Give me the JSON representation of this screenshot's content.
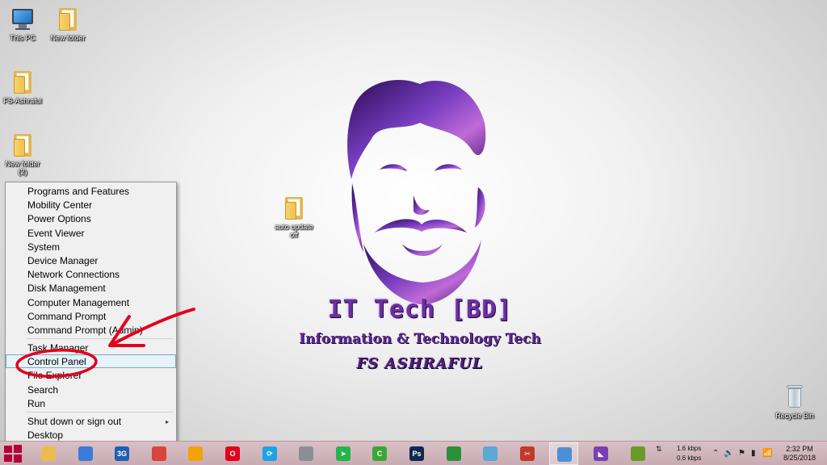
{
  "desktop": {
    "icons": [
      {
        "label": "This PC",
        "icon": "this-pc-icon"
      },
      {
        "label": "New folder",
        "icon": "folder-icon"
      },
      {
        "label": "FS-Ashraful",
        "icon": "folder-icon"
      },
      {
        "label": "New folder\n(2)",
        "icon": "folder-icon"
      },
      {
        "label": "auto update\noff",
        "icon": "folder-icon"
      },
      {
        "label": "Recycle Bin",
        "icon": "recycle-bin-icon"
      }
    ]
  },
  "wallpaper": {
    "title": "IT Tech [BD]",
    "subtitle": "Information & Technology Tech",
    "author": "FS ASHRAFUL"
  },
  "winx_menu": {
    "items": [
      "Programs and Features",
      "Mobility Center",
      "Power Options",
      "Event Viewer",
      "System",
      "Device Manager",
      "Network Connections",
      "Disk Management",
      "Computer Management",
      "Command Prompt",
      "Command Prompt (Admin)",
      "Task Manager",
      "Control Panel",
      "File Explorer",
      "Search",
      "Run",
      "Shut down or sign out",
      "Desktop"
    ],
    "selected": "Control Panel",
    "submenu_arrow": "▸"
  },
  "annotation": {
    "color": "#e3001b"
  },
  "taskbar": {
    "start": "windows-start-icon",
    "apps": [
      {
        "icon": "file-explorer-icon",
        "color": "#e9bd4d",
        "glyph": ""
      },
      {
        "icon": "webcam-icon",
        "color": "#3a7bd5",
        "glyph": ""
      },
      {
        "icon": "3g-modem-icon",
        "color": "#1e5fb3",
        "glyph": "3G"
      },
      {
        "icon": "chrome-icon",
        "color": "#d9443b",
        "glyph": ""
      },
      {
        "icon": "headphones-icon",
        "color": "#f0a30a",
        "glyph": ""
      },
      {
        "icon": "opera-icon",
        "color": "#e0001b",
        "glyph": "O"
      },
      {
        "icon": "sync-icon",
        "color": "#1aa3e8",
        "glyph": "⟳"
      },
      {
        "icon": "hardware-icon",
        "color": "#8a8f96",
        "glyph": ""
      },
      {
        "icon": "send-icon",
        "color": "#27b34a",
        "glyph": "➤"
      },
      {
        "icon": "camtasia-icon",
        "color": "#3aa834",
        "glyph": "C"
      },
      {
        "icon": "photoshop-icon",
        "color": "#0d2b4f",
        "glyph": "Ps"
      },
      {
        "icon": "globe-icon",
        "color": "#2c8f3c",
        "glyph": ""
      },
      {
        "icon": "notepad-icon",
        "color": "#5aa9d6",
        "glyph": ""
      },
      {
        "icon": "snipping-tool-icon",
        "color": "#c0392b",
        "glyph": "✂"
      },
      {
        "icon": "paint-icon",
        "color": "#4d8fd6",
        "glyph": ""
      },
      {
        "icon": "visual-studio-icon",
        "color": "#7b3fb5",
        "glyph": "◣"
      },
      {
        "icon": "chart-app-icon",
        "color": "#6a9a2a",
        "glyph": ""
      }
    ],
    "active_index": 14,
    "network_speed": {
      "up": "1.6 kbps",
      "down": "0.6 kbps"
    },
    "time": "2:32 PM",
    "date": "8/25/2018"
  }
}
